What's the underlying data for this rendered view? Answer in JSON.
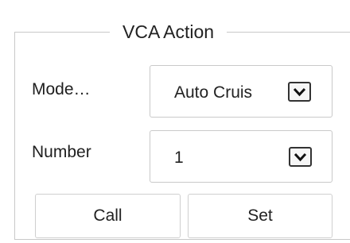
{
  "panel": {
    "title": "VCA Action"
  },
  "mode": {
    "label": "Mode…",
    "value": "Auto Cruis"
  },
  "number": {
    "label": "Number",
    "value": "1"
  },
  "buttons": {
    "call_label": "Call",
    "set_label": "Set"
  },
  "icons": {
    "dropdown": "chevron-down-icon"
  },
  "colors": {
    "border": "#c8c8c8",
    "text": "#222222",
    "background": "#ffffff"
  }
}
